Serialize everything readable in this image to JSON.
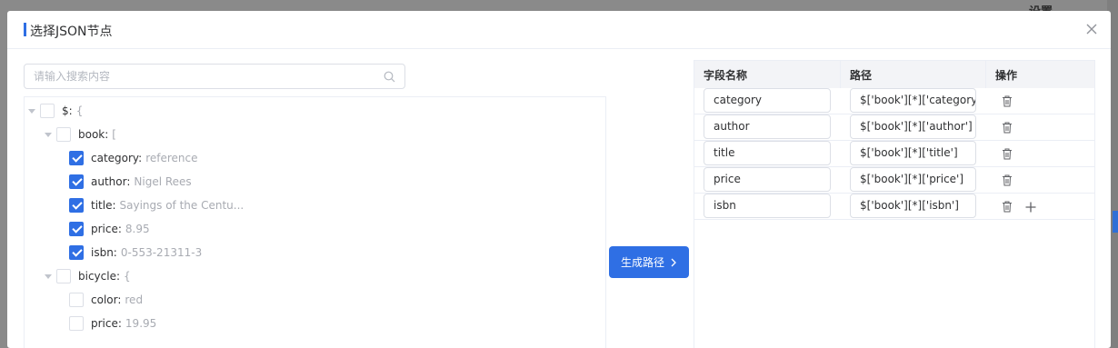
{
  "background": {
    "label": "设置"
  },
  "dialog": {
    "title": "选择JSON节点",
    "search": {
      "placeholder": "请输入搜索内容",
      "value": ""
    },
    "tree": {
      "root": {
        "key": "$:",
        "bracket": "{",
        "checked": false
      },
      "book": {
        "key": "book:",
        "bracket": "[",
        "checked": false
      },
      "book_fields": [
        {
          "key": "category:",
          "value": "reference",
          "checked": true
        },
        {
          "key": "author:",
          "value": "Nigel Rees",
          "checked": true
        },
        {
          "key": "title:",
          "value": "Sayings of the Centu...",
          "checked": true
        },
        {
          "key": "price:",
          "value": "8.95",
          "checked": true
        },
        {
          "key": "isbn:",
          "value": "0-553-21311-3",
          "checked": true
        }
      ],
      "bicycle": {
        "key": "bicycle:",
        "bracket": "{",
        "checked": false
      },
      "bicycle_fields": [
        {
          "key": "color:",
          "value": "red",
          "checked": false
        },
        {
          "key": "price:",
          "value": "19.95",
          "checked": false
        }
      ]
    },
    "generate_button": {
      "label": "生成路径",
      "icon": "chevron-right-icon"
    },
    "table": {
      "headers": {
        "field_name": "字段名称",
        "path": "路径",
        "actions": "操作"
      },
      "rows": [
        {
          "field": "category",
          "path": "$['book'][*]['category']"
        },
        {
          "field": "author",
          "path": "$['book'][*]['author']"
        },
        {
          "field": "title",
          "path": "$['book'][*]['title']"
        },
        {
          "field": "price",
          "path": "$['book'][*]['price']"
        },
        {
          "field": "isbn",
          "path": "$['book'][*]['isbn']"
        }
      ]
    }
  }
}
